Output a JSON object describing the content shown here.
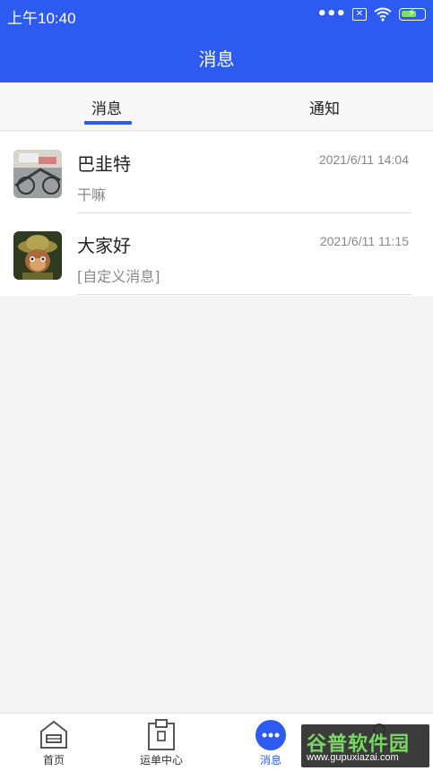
{
  "status_bar": {
    "time": "上午10:40"
  },
  "header": {
    "title": "消息"
  },
  "tabs": [
    {
      "label": "消息",
      "active": true
    },
    {
      "label": "通知",
      "active": false
    }
  ],
  "conversations": [
    {
      "name": "巴韭特",
      "time": "2021/6/11 14:04",
      "preview": "干嘛"
    },
    {
      "name": "大家好",
      "time": "2021/6/11 11:15",
      "preview": "[自定义消息]"
    }
  ],
  "bottom_nav": [
    {
      "label": "首页",
      "icon": "home-icon"
    },
    {
      "label": "运单中心",
      "icon": "clipboard-icon"
    },
    {
      "label": "消息",
      "icon": "chat-bubble-icon",
      "active": true
    },
    {
      "label": "",
      "icon": "profile-icon"
    }
  ],
  "watermark": {
    "title": "谷普软件园",
    "url": "www.gupuxiazai.com"
  },
  "colors": {
    "accent": "#2d5bf2",
    "battery": "#7ddf64",
    "watermark_green": "#6fd35a"
  }
}
